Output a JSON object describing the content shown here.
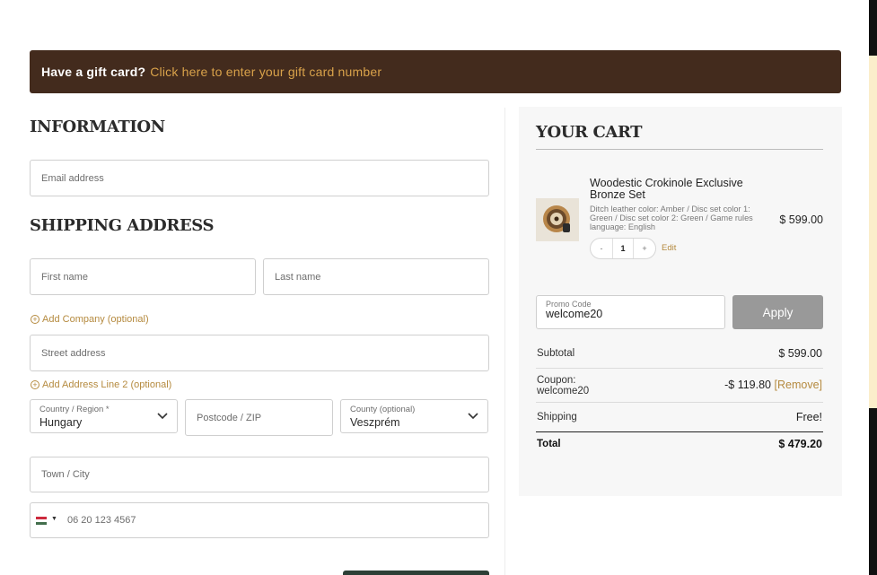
{
  "gift_banner": {
    "prompt": "Have a gift card?",
    "link": "Click here to enter your gift card number"
  },
  "information": {
    "title": "INFORMATION",
    "email_placeholder": "Email address"
  },
  "shipping": {
    "title": "SHIPPING ADDRESS",
    "first_name_placeholder": "First name",
    "last_name_placeholder": "Last name",
    "add_company": "Add Company (optional)",
    "street_placeholder": "Street address",
    "add_address_line2": "Add Address Line 2 (optional)",
    "country_label": "Country / Region *",
    "country_value": "Hungary",
    "postcode_placeholder": "Postcode / ZIP",
    "county_label": "County (optional)",
    "county_value": "Veszprém",
    "town_placeholder": "Town / City",
    "phone_value": "06 20 123 4567"
  },
  "cart": {
    "title": "YOUR CART",
    "item": {
      "name": "Woodestic Crokinole Exclusive Bronze Set",
      "variant": "Ditch leather color: Amber / Disc set color 1: Green / Disc set color 2: Green / Game rules language: English",
      "price": "$ 599.00",
      "quantity": "1",
      "decrement": "-",
      "increment": "+",
      "edit_label": "Edit"
    },
    "promo": {
      "label": "Promo Code",
      "value": "welcome20",
      "apply_label": "Apply"
    },
    "summary": {
      "subtotal_label": "Subtotal",
      "subtotal_value": "$ 599.00",
      "coupon_label": "Coupon:",
      "coupon_code": "welcome20",
      "coupon_value": "-$ 119.80",
      "remove_label": "[Remove]",
      "shipping_label": "Shipping",
      "shipping_value": "Free!",
      "total_label": "Total",
      "total_value": "$ 479.20"
    }
  },
  "colors": {
    "banner_bg": "#432b1d",
    "accent_gold": "#b58a3f",
    "apply_button": "#999999",
    "cart_bg": "#f7f7f7"
  }
}
